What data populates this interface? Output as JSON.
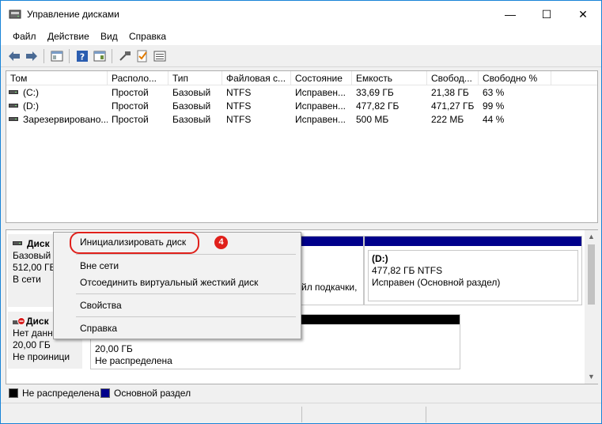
{
  "window": {
    "title": "Управление дисками",
    "minimize_glyph": "—",
    "maximize_glyph": "☐",
    "close_glyph": "✕"
  },
  "menu": [
    "Файл",
    "Действие",
    "Вид",
    "Справка"
  ],
  "toolbar_icons": [
    "back-arrow-icon",
    "forward-arrow-icon",
    "console-tree-icon",
    "help-icon",
    "properties-icon",
    "connect-icon",
    "checklist-icon",
    "list-view-icon"
  ],
  "volumes": {
    "columns": [
      "Том",
      "Располо...",
      "Тип",
      "Файловая с...",
      "Состояние",
      "Емкость",
      "Свобод...",
      "Свободно %"
    ],
    "rows": [
      [
        "(C:)",
        "Простой",
        "Базовый",
        "NTFS",
        "Исправен...",
        "33,69 ГБ",
        "21,38 ГБ",
        "63 %"
      ],
      [
        "(D:)",
        "Простой",
        "Базовый",
        "NTFS",
        "Исправен...",
        "477,82 ГБ",
        "471,27 ГБ",
        "99 %"
      ],
      [
        "Зарезервировано...",
        "Простой",
        "Базовый",
        "NTFS",
        "Исправен...",
        "500 МБ",
        "222 МБ",
        "44 %"
      ]
    ]
  },
  "disks": {
    "disk0": {
      "name": "Диск",
      "type": "Базовый",
      "size": "512,00 ГБ",
      "status": "В сети",
      "partition_fragment": "йл подкачки,",
      "partition_d": {
        "label": "(D:)",
        "size_fs": "477,82 ГБ NTFS",
        "status": "Исправен (Основной раздел)"
      }
    },
    "disk1": {
      "name": "Диск",
      "type": "Нет данн",
      "size": "20,00 ГБ",
      "status": "Не проиници",
      "partition": {
        "size": "20,00 ГБ",
        "status": "Не распределена"
      }
    }
  },
  "legend": [
    {
      "label": "Не распределена",
      "color": "#000000"
    },
    {
      "label": "Основной раздел",
      "color": "#00008b"
    }
  ],
  "context_menu": {
    "items": [
      "Инициализировать диск",
      "Вне сети",
      "Отсоединить виртуальный жесткий диск",
      "Свойства",
      "Справка"
    ]
  },
  "annotation": {
    "badge": "4",
    "color": "#e0201b"
  }
}
